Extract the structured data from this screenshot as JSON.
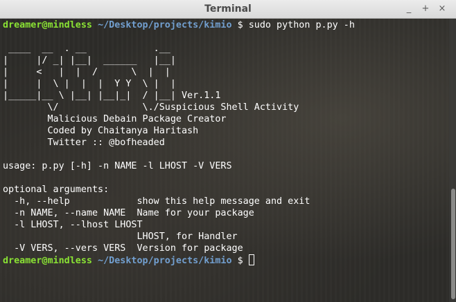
{
  "window": {
    "title": "Terminal",
    "btn_min": "_",
    "btn_max": "+",
    "btn_close": "×"
  },
  "prompt": {
    "user": "dreamer@mindless",
    "path": "~/Desktop/projects/kimio",
    "symbol": "$"
  },
  "command": "sudo python p.py -h",
  "banner": [
    " ____  __  . __            .__",
    "|     |/ _| |__|  ______   |__|",
    "|     <   |  |  /      \\  |  |",
    "|     |  \\ |  |  |  Y Y  \\ |  |",
    "|_____|__ \\ |__| |__|_|  / |__| Ver.1.1",
    "        \\/               \\./Suspicious Shell Activity",
    "        Malicious Debain Package Creator",
    "        Coded by Chaitanya Haritash",
    "        Twitter :: @bofheaded"
  ],
  "help": [
    "usage: p.py [-h] -n NAME -l LHOST -V VERS",
    "",
    "optional arguments:",
    "  -h, --help            show this help message and exit",
    "  -n NAME, --name NAME  Name for your package",
    "  -l LHOST, --lhost LHOST",
    "                        LHOST, for Handler",
    "  -V VERS, --vers VERS  Version for package"
  ],
  "colors": {
    "user": "#8ae234",
    "path": "#729fcf",
    "text": "#ffffff",
    "titlebar": "#e3e3e3"
  }
}
